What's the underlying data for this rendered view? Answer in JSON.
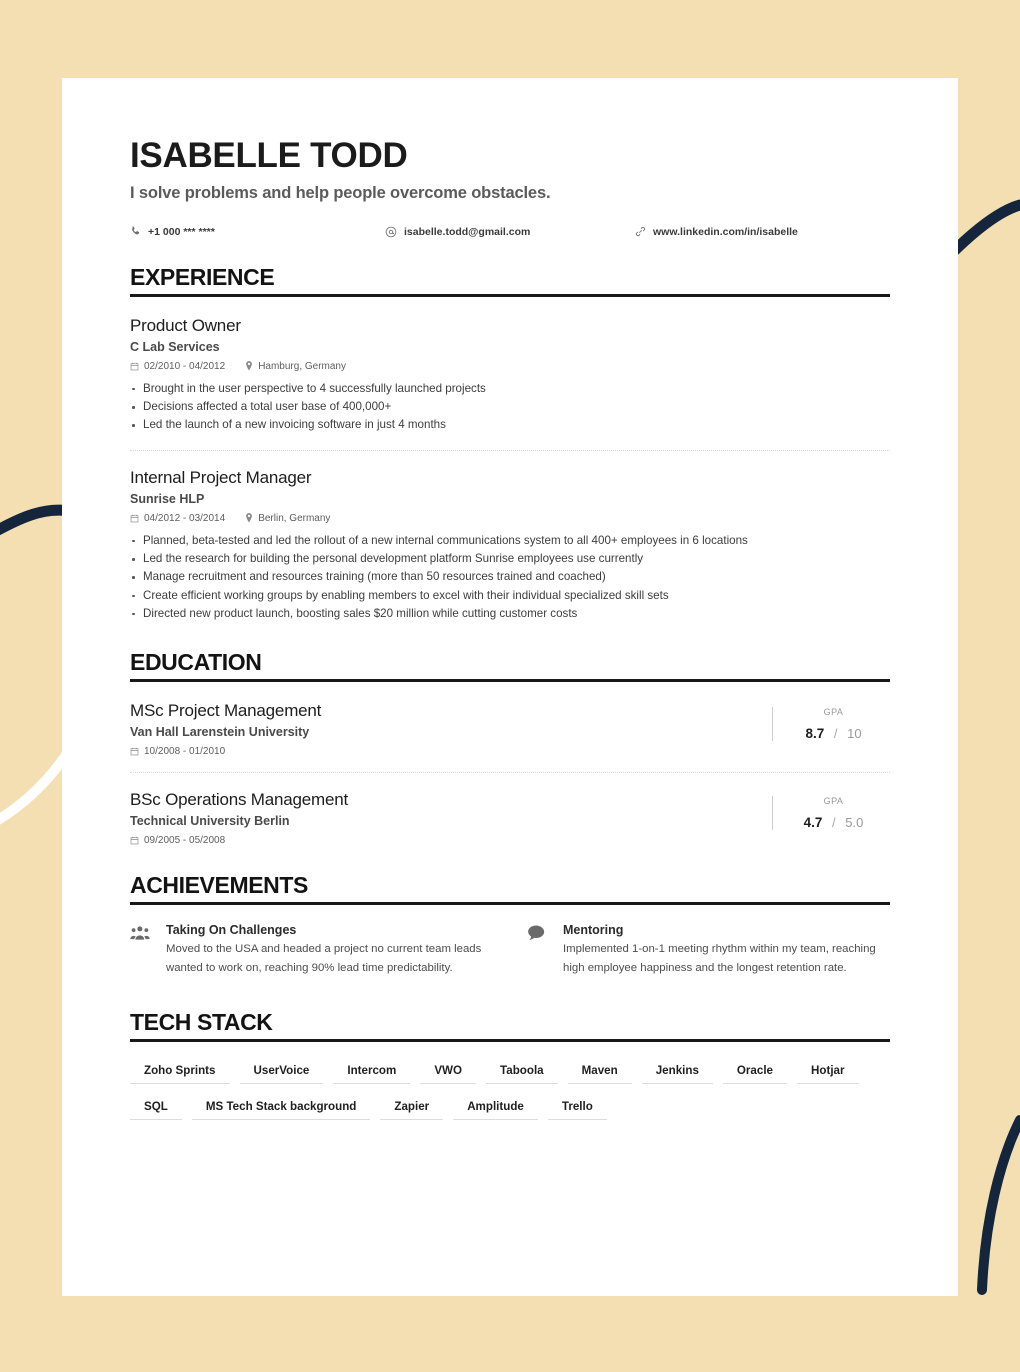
{
  "theme": {
    "background_color": "#F3DFB2",
    "page_color": "#FFFFFF",
    "ink_color": "#1B1B1B",
    "accent_dark_curve": "#14253C",
    "accent_light_curve": "#FFFFFF"
  },
  "header": {
    "name": "ISABELLE TODD",
    "tagline": "I solve problems and help people overcome obstacles.",
    "contacts": [
      {
        "icon": "phone-icon",
        "value": "+1 000 *** ****"
      },
      {
        "icon": "at-sign-icon",
        "value": "isabelle.todd@gmail.com"
      },
      {
        "icon": "link-icon",
        "value": "www.linkedin.com/in/isabelle"
      }
    ]
  },
  "sections": {
    "experience": {
      "title": "EXPERIENCE",
      "entries": [
        {
          "role": "Product Owner",
          "organization": "C Lab Services",
          "dates": "02/2010 - 04/2012",
          "location": "Hamburg, Germany",
          "bullets": [
            "Brought in the user perspective to 4 successfully launched projects",
            "Decisions affected a total user base of 400,000+",
            "Led the launch of a new invoicing software in just 4 months"
          ]
        },
        {
          "role": "Internal Project Manager",
          "organization": "Sunrise HLP",
          "dates": "04/2012 - 03/2014",
          "location": "Berlin, Germany",
          "bullets": [
            "Planned, beta-tested and led the rollout of a new internal communications system to all 400+ employees in 6 locations",
            "Led the research for building the personal development platform Sunrise employees use currently",
            "Manage recruitment and resources training (more than 50 resources trained and coached)",
            "Create efficient working groups by enabling members to excel with their individual specialized skill sets",
            "Directed new product launch, boosting sales $20 million while cutting customer costs"
          ]
        }
      ]
    },
    "education": {
      "title": "EDUCATION",
      "entries": [
        {
          "degree": "MSc Project Management",
          "institution": "Van Hall Larenstein University",
          "dates": "10/2008 - 01/2010",
          "gpa_label": "GPA",
          "gpa_value": "8.7",
          "gpa_separator": "/",
          "gpa_scale": "10"
        },
        {
          "degree": "BSc Operations Management",
          "institution": "Technical University Berlin",
          "dates": "09/2005 - 05/2008",
          "gpa_label": "GPA",
          "gpa_value": "4.7",
          "gpa_separator": "/",
          "gpa_scale": "5.0"
        }
      ]
    },
    "achievements": {
      "title": "ACHIEVEMENTS",
      "items": [
        {
          "icon": "people-group-icon",
          "title": "Taking On Challenges",
          "description": "Moved to the USA and headed a project no current team leads wanted to work on, reaching 90% lead time predictability."
        },
        {
          "icon": "speech-bubble-icon",
          "title": "Mentoring",
          "description": "Implemented 1-on-1 meeting rhythm within my team, reaching high employee happiness and the longest retention rate."
        }
      ]
    },
    "tech_stack": {
      "title": "TECH STACK",
      "tags": [
        "Zoho Sprints",
        "UserVoice",
        "Intercom",
        "VWO",
        "Taboola",
        "Maven",
        "Jenkins",
        "Oracle",
        "Hotjar",
        "SQL",
        "MS Tech Stack background",
        "Zapier",
        "Amplitude",
        "Trello"
      ]
    }
  }
}
